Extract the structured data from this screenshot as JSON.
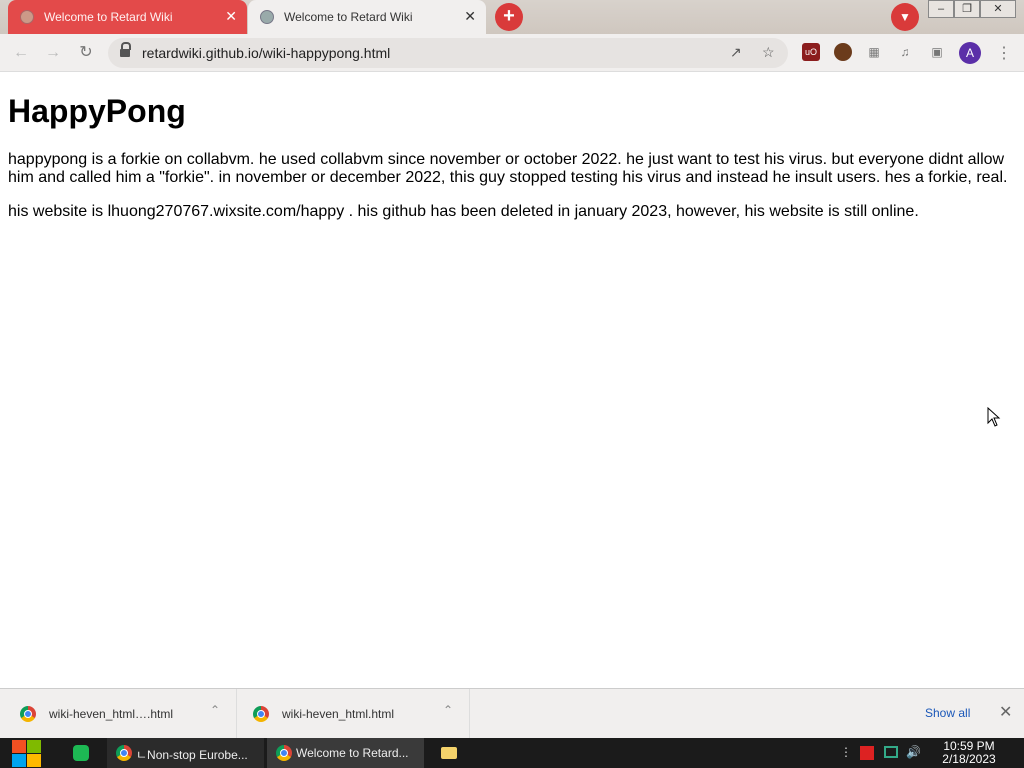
{
  "browser": {
    "tabs": [
      {
        "title": "Welcome to Retard Wiki",
        "active": false
      },
      {
        "title": "Welcome to Retard Wiki",
        "active": true
      }
    ],
    "close_glyph": "✕",
    "new_tab_glyph": "+",
    "url": "retardwiki.github.io/wiki-happypong.html",
    "profile_initial": "A",
    "accent_color": "#e34a4a",
    "toolbar_icons": [
      "back-icon",
      "forward-icon",
      "reload-icon",
      "lock-icon",
      "share-icon",
      "star-icon",
      "ublock-icon",
      "extension-avatar-icon",
      "puzzle-icon",
      "media-icon",
      "side-panel-icon",
      "menu-icon"
    ]
  },
  "page": {
    "heading": "HappyPong",
    "paragraphs": [
      "happypong is a forkie on collabvm. he used collabvm since november or october 2022. he just want to test his virus. but everyone didnt allow him and called him a \"forkie\". in november or december 2022, this guy stopped testing his virus and instead he insult users. hes a forkie, real.",
      "his website is lhuong270767.wixsite.com/happy . his github has been deleted in january 2023, however, his website is still online."
    ]
  },
  "downloads": {
    "items": [
      {
        "name": "wiki-heven_html….html"
      },
      {
        "name": "wiki-heven_html.html"
      }
    ],
    "show_all": "Show all",
    "close_glyph": "✕"
  },
  "taskbar": {
    "tasks": [
      {
        "label": "ㄴNon-stop Eurobe..."
      },
      {
        "label": "Welcome to Retard..."
      }
    ],
    "time": "10:59 PM",
    "date": "2/18/2023"
  }
}
